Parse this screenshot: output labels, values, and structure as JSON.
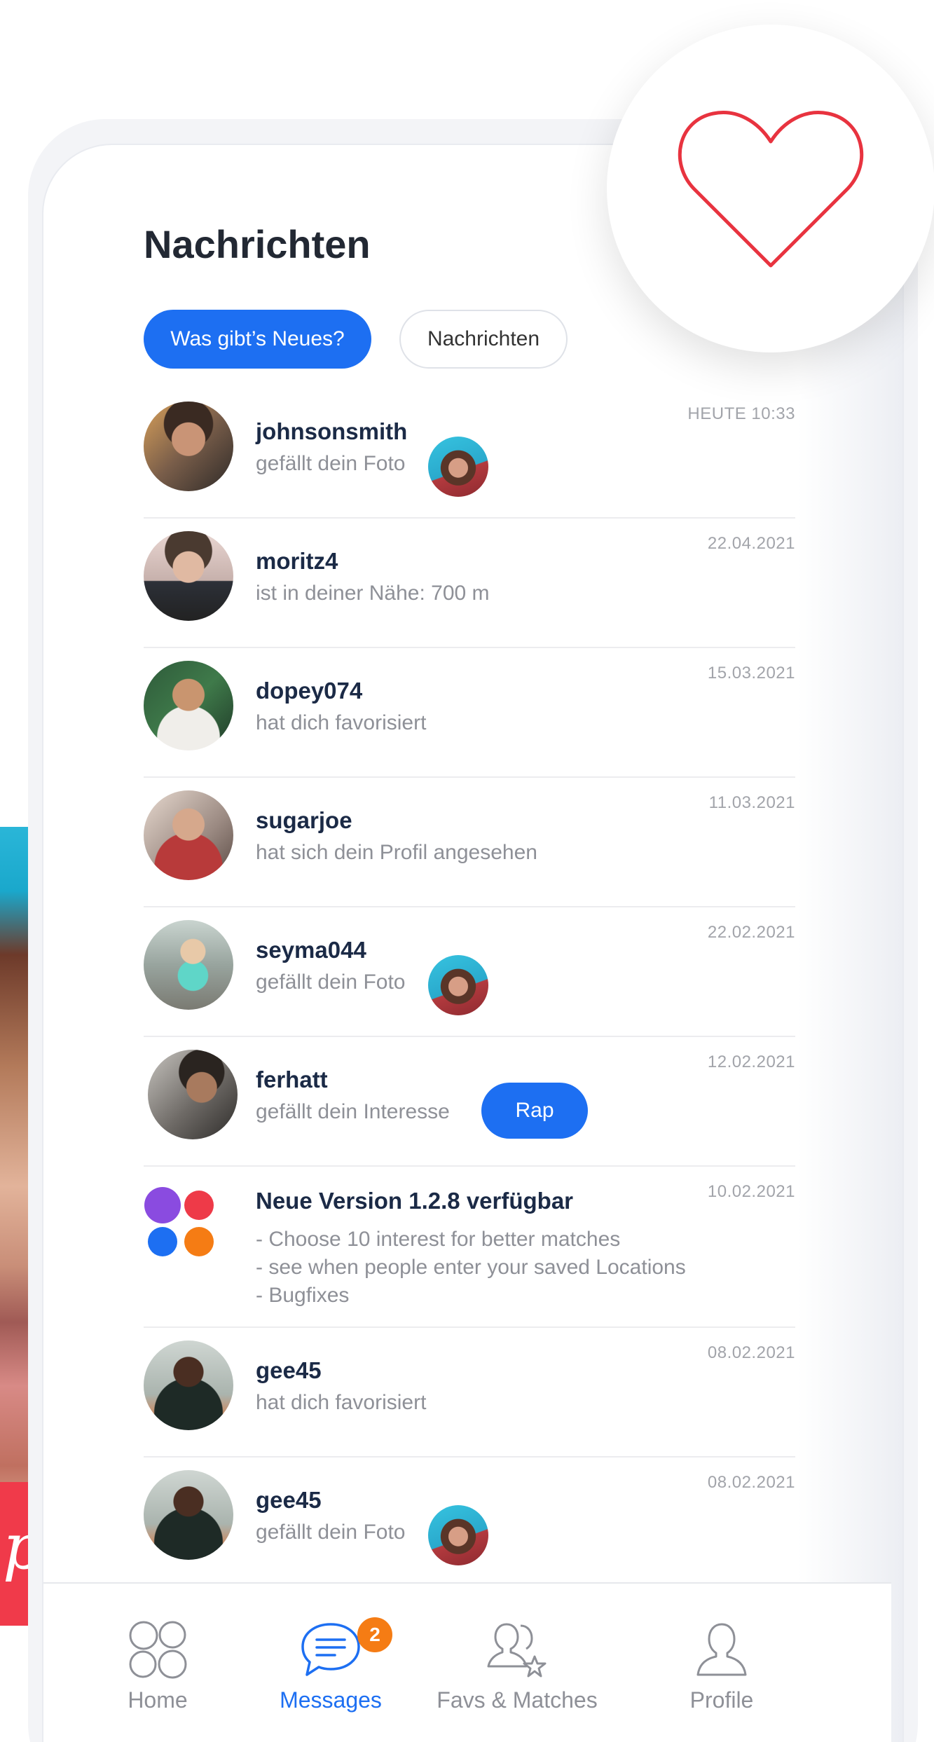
{
  "header": {
    "title": "Nachrichten"
  },
  "tabs": [
    {
      "label": "Was gibt’s Neues?",
      "active": true
    },
    {
      "label": "Nachrichten",
      "active": false
    }
  ],
  "messages": [
    {
      "name": "johnsonsmith",
      "text": "gefällt dein Foto",
      "date": "HEUTE 10:33",
      "attachment": "photo-thumbnail"
    },
    {
      "name": "moritz4",
      "text": "ist in deiner Nähe: 700 m",
      "date": "22.04.2021"
    },
    {
      "name": "dopey074",
      "text": "hat dich favorisiert",
      "date": "15.03.2021"
    },
    {
      "name": "sugarjoe",
      "text": "hat sich dein Profil angesehen",
      "date": "11.03.2021"
    },
    {
      "name": "seyma044",
      "text": "gefällt dein Foto",
      "date": "22.02.2021",
      "attachment": "photo-thumbnail"
    },
    {
      "name": "ferhatt",
      "text": "gefällt dein Interesse",
      "date": "12.02.2021",
      "interest": "Rap"
    },
    {
      "name": "Neue Version 1.2.8 verfügbar",
      "lines": [
        "- Choose 10 interest for better matches",
        "- see when people enter your saved Locations",
        "- Bugfixes"
      ],
      "date": "10.02.2021"
    },
    {
      "name": "gee45",
      "text": "hat dich favorisiert",
      "date": "08.02.2021"
    },
    {
      "name": "gee45",
      "text": "gefällt dein Foto",
      "date": "08.02.2021",
      "attachment": "photo-thumbnail"
    }
  ],
  "nav": [
    {
      "label": "Home",
      "icon": "home-icon"
    },
    {
      "label": "Messages",
      "icon": "messages-icon",
      "badge": "2",
      "active": true
    },
    {
      "label": "Favs & Matches",
      "icon": "favs-matches-icon"
    },
    {
      "label": "Profile",
      "icon": "profile-icon"
    }
  ],
  "colors": {
    "accent": "#1d6ff2",
    "badge": "#f57c14",
    "heart": "#e8333f"
  }
}
